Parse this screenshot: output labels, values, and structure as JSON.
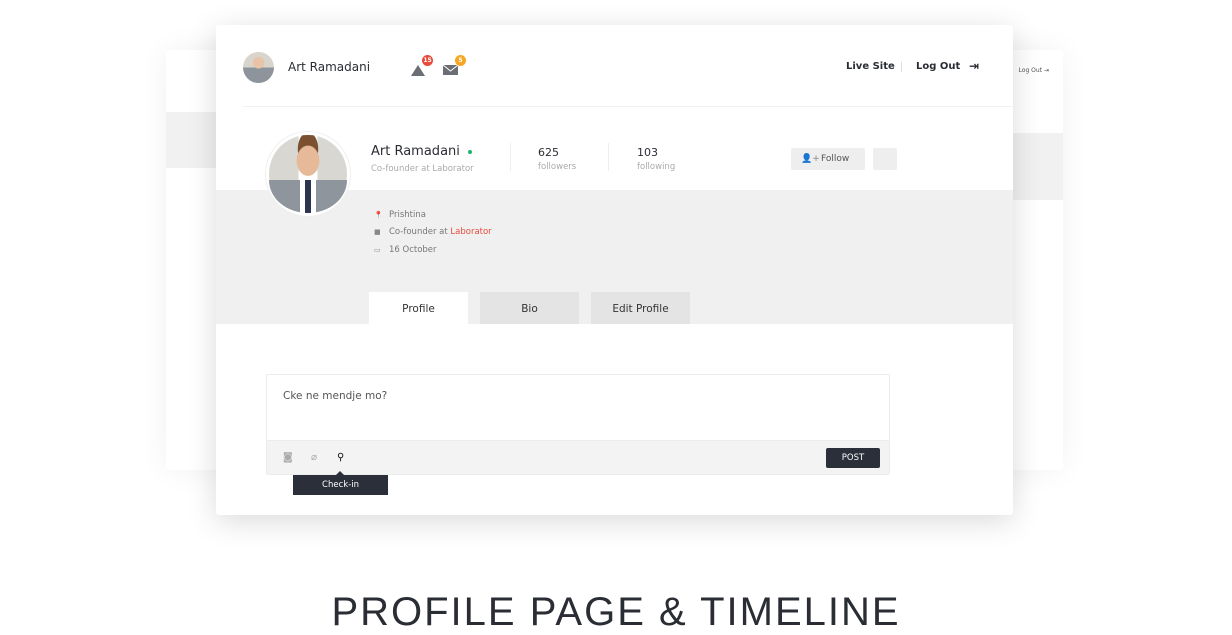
{
  "header": {
    "user_name": "Art Ramadani",
    "notifications_count": "15",
    "messages_count": "5",
    "live_site": "Live Site",
    "log_out": "Log Out",
    "back_log_out": "Log Out"
  },
  "profile": {
    "name": "Art Ramadani",
    "status": "online",
    "subtitle": "Co-founder at Laborator",
    "followers_count": "625",
    "followers_label": "followers",
    "following_count": "103",
    "following_label": "following",
    "follow_label": "Follow",
    "location": "Prishtina",
    "job_prefix": "Co-founder at",
    "job_company": "Laborator",
    "date": "16 October"
  },
  "tabs": [
    {
      "label": "Profile",
      "active": true
    },
    {
      "label": "Bio",
      "active": false
    },
    {
      "label": "Edit Profile",
      "active": false
    }
  ],
  "composer": {
    "placeholder": "Cke ne mendje mo?",
    "post_label": "POST",
    "tooltip": "Check-in"
  },
  "caption": "PROFILE PAGE & TIMELINE",
  "colors": {
    "accent": "#e74c3c",
    "online": "#1fb86a",
    "notif_badge": "#e74c3c",
    "msg_badge": "#f5a623",
    "dark": "#2b2f3a"
  }
}
